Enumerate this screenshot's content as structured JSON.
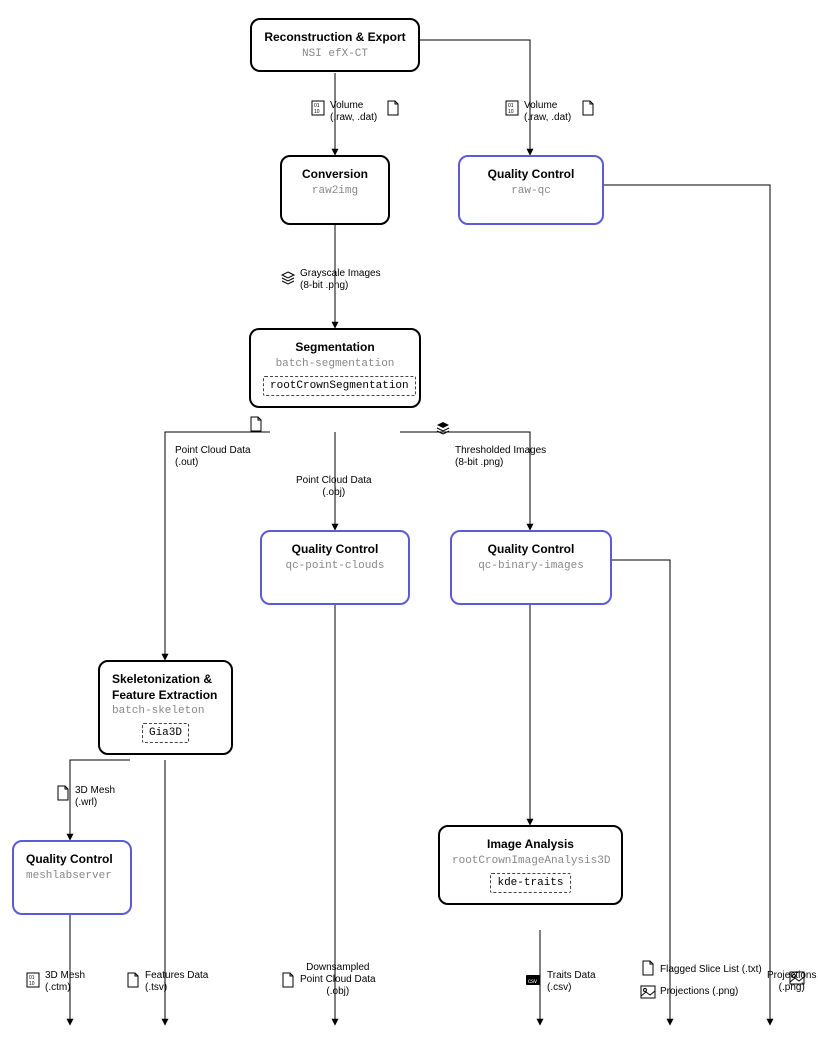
{
  "nodes": {
    "reconstruction": {
      "title": "Reconstruction & Export",
      "sub": "NSI efX-CT"
    },
    "conversion": {
      "title": "Conversion",
      "sub": "raw2img"
    },
    "qc_raw": {
      "title": "Quality Control",
      "sub": "raw-qc"
    },
    "segmentation": {
      "title": "Segmentation",
      "sub": "batch-segmentation",
      "inner": "rootCrownSegmentation"
    },
    "qc_pc": {
      "title": "Quality Control",
      "sub": "qc-point-clouds"
    },
    "qc_bi": {
      "title": "Quality Control",
      "sub": "qc-binary-images"
    },
    "skeleton": {
      "title": "Skeletonization & Feature Extraction",
      "sub": "batch-skeleton",
      "inner": "Gia3D"
    },
    "qc_mesh": {
      "title": "Quality Control",
      "sub": "meshlabserver"
    },
    "analysis": {
      "title": "Image Analysis",
      "sub": "rootCrownImageAnalysis3D",
      "inner": "kde-traits"
    }
  },
  "edges": {
    "vol1": {
      "l1": "Volume",
      "l2": "(.raw, .dat)"
    },
    "vol2": {
      "l1": "Volume",
      "l2": "(.raw, .dat)"
    },
    "gray": {
      "l1": "Grayscale Images",
      "l2": "(8-bit .png)"
    },
    "pcd_out": {
      "l1": "Point Cloud Data",
      "l2": "(.out)"
    },
    "pcd_obj": {
      "l1": "Point Cloud Data",
      "l2": "(.obj)"
    },
    "thresh": {
      "l1": "Thresholded Images",
      "l2": "(8-bit .png)"
    },
    "mesh_wrl": {
      "l1": "3D Mesh",
      "l2": "(.wrl)"
    },
    "mesh_ctm": {
      "l1": "3D Mesh",
      "l2": "(.ctm)"
    },
    "features": {
      "l1": "Features Data",
      "l2": "(.tsv)"
    },
    "downsampled": {
      "l1": "Downsampled",
      "l2": "Point Cloud Data",
      "l3": "(.obj)"
    },
    "traits": {
      "l1": "Traits Data",
      "l2": "(.csv)"
    },
    "flagged": {
      "l1": "Flagged Slice List (.txt)"
    },
    "proj1": {
      "l1": "Projections (.png)"
    },
    "proj2": {
      "l1": "Projections",
      "l2": "(.png)"
    }
  }
}
